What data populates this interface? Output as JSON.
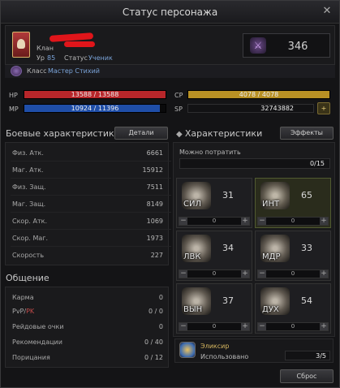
{
  "window": {
    "title": "Статус персонажа",
    "close_glyph": "✕"
  },
  "profile": {
    "clan_label": "Клан",
    "level_label": "Ур",
    "level": "85",
    "status_label": "Статус",
    "status_value": "Ученик",
    "score": "346",
    "class_label": "Класс",
    "class_value": "Мастер Стихий"
  },
  "bars": {
    "hp": {
      "label": "HP",
      "text": "13588 / 13588",
      "current": 13588,
      "max": 13588,
      "color": "#b8262a"
    },
    "mp": {
      "label": "MP",
      "text": "10924 / 11396",
      "current": 10924,
      "max": 11396,
      "color": "#1f4ea8"
    },
    "cp": {
      "label": "CP",
      "text": "4078 / 4078",
      "current": 4078,
      "max": 4078,
      "color": "#b89024"
    },
    "sp": {
      "label": "SP",
      "text": "32743882"
    }
  },
  "combat": {
    "title": "Боевые характеристики",
    "details_button": "Детали",
    "rows": [
      {
        "k": "Физ. Атк.",
        "v": "6661"
      },
      {
        "k": "Маг. Атк.",
        "v": "15912"
      },
      {
        "k": "Физ. Защ.",
        "v": "7511"
      },
      {
        "k": "Маг. Защ.",
        "v": "8149"
      },
      {
        "k": "Скор. Атк.",
        "v": "1069"
      },
      {
        "k": "Скор. Маг.",
        "v": "1973"
      },
      {
        "k": "Скорость",
        "v": "227"
      }
    ]
  },
  "social": {
    "title": "Общение",
    "rows": [
      {
        "k": "Карма",
        "v": "0"
      },
      {
        "k_pvp": "PvP/",
        "k_pk": "PK",
        "v": "0 / 0"
      },
      {
        "k": "Рейдовые очки",
        "v": "0"
      },
      {
        "k": "Рекомендации",
        "v": "0 / 40"
      },
      {
        "k": "Порицания",
        "v": "0 / 12"
      }
    ]
  },
  "attrs": {
    "title": "Характеристики",
    "effects_button": "Эффекты",
    "can_spend_label": "Можно потратить",
    "can_spend_value": "0/15",
    "tiles": [
      {
        "name": "СИЛ",
        "value": "31",
        "alloc": "0"
      },
      {
        "name": "ИНТ",
        "value": "65",
        "alloc": "0"
      },
      {
        "name": "ЛВК",
        "value": "34",
        "alloc": "0"
      },
      {
        "name": "МДР",
        "value": "33",
        "alloc": "0"
      },
      {
        "name": "ВЫН",
        "value": "37",
        "alloc": "0"
      },
      {
        "name": "ДУХ",
        "value": "54",
        "alloc": "0"
      }
    ],
    "elixir_label": "Эликсир",
    "elixir_used_label": "Использовано",
    "elixir_used_value": "3/5",
    "reset_button": "Сброс"
  },
  "colors": {
    "accent_gold": "#b89024",
    "hp": "#b8262a",
    "mp": "#1f4ea8"
  }
}
